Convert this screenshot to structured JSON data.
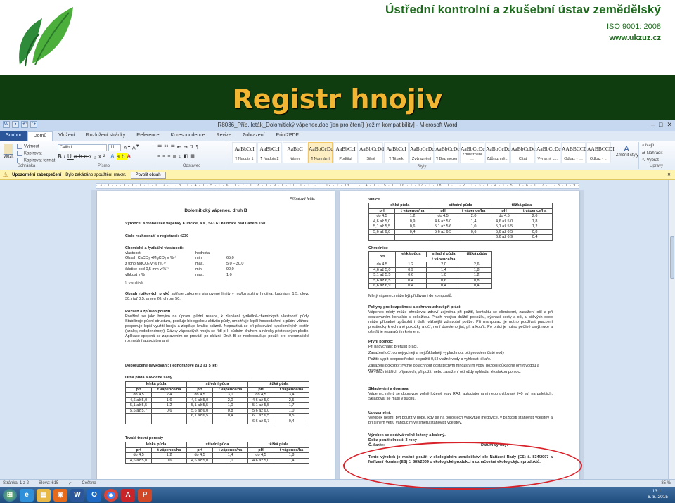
{
  "slide": {
    "org_name": "Ústřední kontrolní a zkušební ústav zemědělský",
    "iso": "ISO 9001: 2008",
    "web": "www.ukzuz.cz",
    "title": "Registr hnojiv",
    "colors": {
      "band": "#0f3d0f",
      "title": "#f2b632",
      "org": "#1e6b1e",
      "ellipse": "#d8222a"
    }
  },
  "window": {
    "title": "R8036_Příb. leták_Dolomitický vápenec.doc [jen pro čtení] [režim kompatibility] - Microsoft Word",
    "tabs": [
      "Soubor",
      "Domů",
      "Vložení",
      "Rozložení stránky",
      "Reference",
      "Korespondence",
      "Revize",
      "Zobrazení",
      "Print2PDF"
    ],
    "active_tab": "Domů"
  },
  "ribbon": {
    "paste": "Vložit",
    "cut": "Vyjmout",
    "copy": "Kopírovat",
    "format_painter": "Kopírovat formát",
    "clipboard_group": "Schránka",
    "font_name": "Calibri",
    "font_size": "11",
    "font_group": "Písmo",
    "paragraph_group": "Odstavec",
    "styles": [
      {
        "sample": "AaBbCcI",
        "name": "¶ Nadpis 1"
      },
      {
        "sample": "AaBbCcI",
        "name": "¶ Nadpis 2"
      },
      {
        "sample": "AaBbC",
        "name": "Název"
      },
      {
        "sample": "AaBbCcDc",
        "name": "¶ Normální"
      },
      {
        "sample": "AaBbCcI",
        "name": "Podtitul"
      },
      {
        "sample": "AaBbCcDd",
        "name": "Silné"
      },
      {
        "sample": "AaBbCcI",
        "name": "¶ Titulek"
      },
      {
        "sample": "AaBbCcDc",
        "name": "Zvýraznění"
      },
      {
        "sample": "AaBbCcDc",
        "name": "¶ Bez mezer"
      },
      {
        "sample": "AaBbCcDc",
        "name": "Zdůraznění ..."
      },
      {
        "sample": "AaBbCcDc",
        "name": "Zdůraznně..."
      },
      {
        "sample": "AaBbCcDc",
        "name": "Citát"
      },
      {
        "sample": "AaBbCcDc",
        "name": "Výrazný ci..."
      },
      {
        "sample": "AABBCCDI",
        "name": "Odkaz - j..."
      },
      {
        "sample": "AABBCCDI",
        "name": "Odkaz - ..."
      }
    ],
    "styles_group": "Styly",
    "change_styles": "Změnit styly",
    "find": "Najít",
    "replace": "Nahradit",
    "select": "Vybrat",
    "editing_group": "Úpravy"
  },
  "security_bar": {
    "title": "Upozornění zabezpečení",
    "message": "Bylo zakázáno spouštění maker.",
    "button": "Povolit obsah"
  },
  "ruler": "· 3 · 1 · 2 · 1 · 1 · 1 · 1 · 1 · 2 · 1 · 3 · 1 · 4 · 1 · 5 · 1 · 6 · 1 · 7 · 1 · 8 · 1 · 9 · 1 · 10 · 1 · 11 · 1 · 12 · 1 · 13 · 1 · 14 · 1 · 15 · 1 · 16 · 1 · 17 · 1 · 18 · 1 · 1 · 2 · 1 · 3 · 1 · 4 · 1 · 5 · 1 · 6 · 1 · 7 · 1 · 8 · 1 · 9 · 1 · 10 · 1 · 11 · 1 · 12 · 1 · 13 · 1 · 14 · 1 · 15 · 1 · 16 · 1 · 17 · 1 ·",
  "page1": {
    "leaflet": "Příbalový leták",
    "heading": "Dolomitický vápenec, druh B",
    "producer": "Výrobce: Krkonošské vápenky Kunčice, a.s., 543 61 Kunčice nad Labem 150",
    "registration": "Číslo rozhodnutí o registraci: 4230",
    "chem_title": "Chemické a fyzikální vlastnosti:",
    "prop_head": "vlastnost:",
    "val_head": "hodnota:",
    "props": [
      {
        "name": "Obsah CaCO₃ +MgCO₃ v %¹⁾",
        "q": "min.",
        "v": "65,0"
      },
      {
        "name": "z toho MgCO₃ v % rel.¹⁾",
        "q": "max.",
        "v": "5,0 – 30,0"
      },
      {
        "name": "částice pod 0,5 mm v %¹⁾",
        "q": "min.",
        "v": "90,0"
      },
      {
        "name": "vlhkost v %",
        "q": "max.",
        "v": "1,0"
      }
    ],
    "footnote": "¹⁾ v sušině",
    "risk_title": "Obsah rizikových prvků",
    "risk_text": "splňuje zákonem stanovené limity v mg/kg sušiny hnojiva: kadmium 1,5, olovo 30, rtuť 0,5, arsen 20, chrom 50.",
    "use_title": "Rozsah a způsob použití",
    "use_text": "Používá se jako hnojivo na úpravu půdní reakce, k zlepšení fyzikálně-chemických vlastností půdy. Stabilizuje půdní strukturu, posiluje biologickou aktivitu půdy, umožňuje lepší hospodaření s půdní vláhou, podporuje lepší využití hnojiv a zlepšuje kvalitu sklizně. Nepoužívá se při pěstování kyselomilných rostlin (azalky, rododendrony). Dávky vápenatých hnojiv se řídí pH, půdním druhem a nároky pěstovaných plodin. Aplikace spojená se zapravením se provádí po sklizni. Druh B se nedoporučuje použít pro pneumatické rozmetání autocisternami.",
    "dose_title": "Doporučené dávkování: (jednorázově za 3 až 5 let)",
    "arable_title": "Orná půda a ovocné sady",
    "grass_title": "Trvalé travní porosty",
    "soil_heads": [
      "lehká půda",
      "střední půda",
      "těžká půda"
    ],
    "col_heads": [
      "pH",
      "t vápence/ha",
      "pH",
      "t vápence/ha",
      "pH",
      "t vápence/ha"
    ],
    "arable_rows": [
      [
        "do 4,5",
        "2,4",
        "do 4,5",
        "3,0",
        "do 4,5",
        "3,4"
      ],
      [
        "4,6 až 5,0",
        "1,6",
        "4,6 až 5,0",
        "2,0",
        "4,6 až 5,0",
        "2,5"
      ],
      [
        "5,1 až 5,5",
        "1,2",
        "5,1 až 5,5",
        "1,0",
        "5,1 až 5,5",
        "1,7"
      ],
      [
        "5,6 až 5,7",
        "0,6",
        "5,6 až 6,0",
        "0,8",
        "5,6 až 6,0",
        "1,0"
      ],
      [
        "",
        "",
        "6,1 až 6,5",
        "0,4",
        "6,1 až 6,5",
        "0,5"
      ],
      [
        "",
        "",
        "",
        "",
        "6,6 až 6,7",
        "0,4"
      ]
    ],
    "grass_rows": [
      [
        "do 4,5",
        "1,2",
        "do 4,5",
        "1,4",
        "do 4,5",
        "1,8"
      ],
      [
        "4,6 až 5,0",
        "0,6",
        "4,6 až 5,0",
        "1,0",
        "4,6 až 5,0",
        "1,4"
      ]
    ]
  },
  "page2": {
    "vine_title": "Vinice",
    "soil_heads": [
      "lehká půda",
      "střední půda",
      "těžká půda"
    ],
    "col_heads": [
      "pH",
      "t vápence/ha",
      "pH",
      "t vápence/ha",
      "pH",
      "t vápence/ha"
    ],
    "vine_rows": [
      [
        "do 4,5",
        "1,2",
        "do 4,5",
        "2,0",
        "do 4,5",
        "2,6"
      ],
      [
        "4,6 až 5,0",
        "0,9",
        "4,6 až 5,0",
        "1,4",
        "4,6 až 5,0",
        "1,8"
      ],
      [
        "5,1 až 5,5",
        "0,6",
        "5,1 až 5,6",
        "1,0",
        "5,1 až 5,5",
        "1,2"
      ],
      [
        "5,6 až 6,0",
        "0,4",
        "5,6 až 6,5",
        "0,6",
        "5,6 až 6,5",
        "0,8"
      ],
      [
        "",
        "",
        "",
        "",
        "6,6 až 6,9",
        "0,4"
      ]
    ],
    "hop_title": "Chmelnice",
    "hop_heads": [
      "pH",
      "lehká půda",
      "střední půda",
      "těžká půda"
    ],
    "hop_sub": "t vápence/ha",
    "hop_rows": [
      [
        "do 4,5",
        "1,2",
        "2,0",
        "2,6"
      ],
      [
        "4,6 až 5,0",
        "0,9",
        "1,4",
        "1,8"
      ],
      [
        "5,1 až 5,5",
        "0,6",
        "1,0",
        "1,2"
      ],
      [
        "5,6 až 6,5",
        "0,4",
        "0,6",
        "0,8"
      ],
      [
        "6,6 až 6,9",
        "0,4",
        "0,4",
        "0,4"
      ]
    ],
    "compost": "Mletý vápenec může být přidáván i do kompostů.",
    "safety_title": "Pokyny pro bezpečnost a ochranu zdraví při práci:",
    "safety_text": "Vápenec mletý může ohrožovat zdraví zejména při požití, kontaktu se sliznicemi, zasažení očí a při opakovaném kontaktu s pokožkou. Prach hnojiva dráždí pokožku, dýchací cesty a oči, u citlivých osob může případně způsobit i další vážnější zdravotní potíže. Při manipulaci je nutno používat pracovní prostředky k ochraně pokožky a očí, není dovoleno jíst, pít a kouřit. Po práci je nutno pečlivě omýt ruce a ošetřit je reparačním krémem.",
    "first_aid": "První pomoc:",
    "aid_lines": [
      "Při nadýchání: přerušit práci.",
      "Zasažení očí: co nejrychleji a nejdůkladněji vypláchnout oči proudem čisté vody",
      "Požití: vypít bezprostředně po požití 0,5 l vlažné vody a vyhledat lékaře.",
      "Zasažení pokožky: rychle opláchnout dostatečným množstvím vody, později důkladně omýt vodou a mýdlem.",
      "Ve všech těžších případech, při požití nebo zasažení očí vždy vyhledat lékařskou pomoc."
    ],
    "storage_title": "Skladování a doprava:",
    "storage_text": "Vápenec mletý se dopravuje volně ložený vozy RAJ, autocisternami nebo pytlovaný (40 kg) na paletách. Skladovat se musí v suchu.",
    "warn_title": "Upozornění:",
    "warn_text": "Výrobek nesmí být použit v době, kdy se na porostech vyskytuje medovice, v blízkosti stanovišť včelstev a při silném větru vanoucím ve směru stanovišť včelstev.",
    "delivery": "Výrobek se dodává volně ložený a balený.",
    "shelf": "Doba použitelnosti: 3 roky",
    "batch": "Č. šarže:",
    "date": "Datum výroby:",
    "eco": "Tento výrobek je možné použít v ekologickém zemědělství dle Nařízení Rady (ES) č. 834/2007 a Nařízení Komise (ES) č. 889/2009 o ekologické produkci a označování ekologických produktů."
  },
  "status": {
    "page": "Stránka: 1 z 2",
    "words": "Slova: 615",
    "lang": "Čeština",
    "zoom": "85 %"
  },
  "taskbar": {
    "time": "13:11",
    "date": "6. 8. 2015",
    "apps": [
      "start-icon",
      "ie-icon",
      "explorer-icon",
      "firefox-icon",
      "word-icon",
      "outlook-icon",
      "chrome-icon",
      "acrobat-icon",
      "powerpoint-icon"
    ]
  }
}
